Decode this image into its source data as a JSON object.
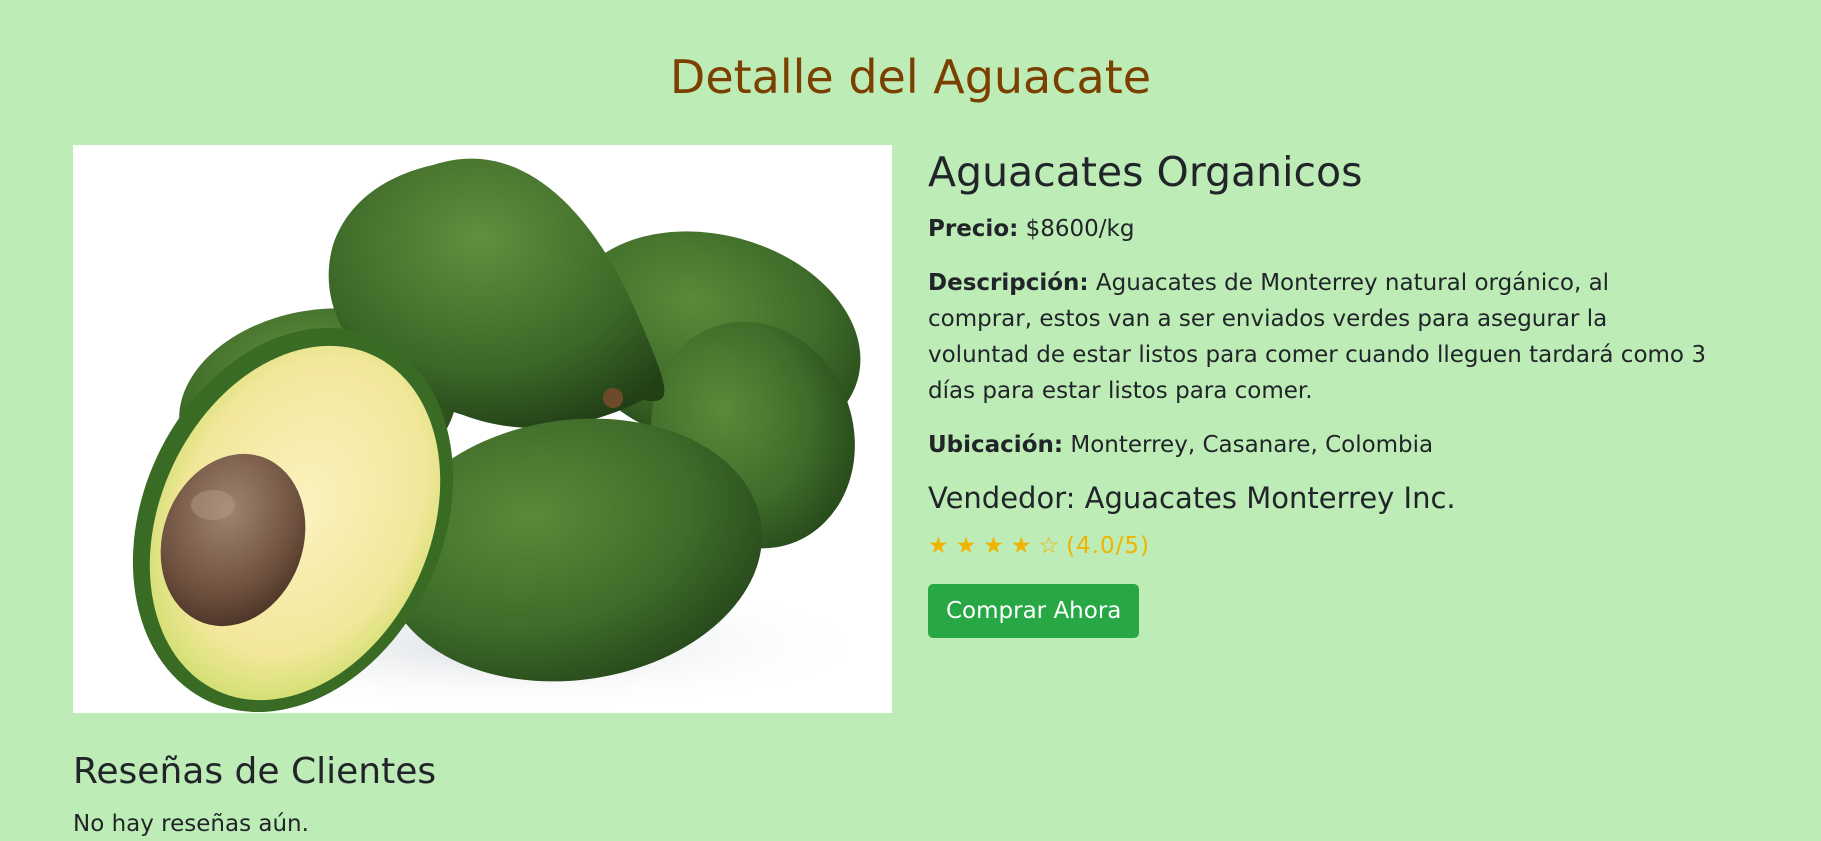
{
  "page": {
    "title": "Detalle del Aguacate"
  },
  "product": {
    "image_alt": "avocados",
    "name": "Aguacates Organicos",
    "price_label": "Precio:",
    "price_value": "$8600/kg",
    "description_label": "Descripción:",
    "description_value": "Aguacates de Monterrey natural orgánico, al comprar, estos van a ser enviados verdes para asegurar la voluntad de estar listos para comer cuando lleguen tardará como 3 días para estar listos para comer.",
    "location_label": "Ubicación:",
    "location_value": "Monterrey, Casanare, Colombia",
    "seller": "Vendedor: Aguacates Monterrey Inc.",
    "rating": {
      "stars": [
        "★",
        "★",
        "★",
        "★",
        "☆"
      ],
      "text": "(4.0/5)",
      "value": 4.0,
      "max": 5,
      "color": "#f0b400"
    },
    "buy_button_label": "Comprar Ahora"
  },
  "reviews": {
    "title": "Reseñas de Clientes",
    "empty_text": "No hay reseñas aún."
  },
  "colors": {
    "background": "#bdecb6",
    "title": "#7b3f00",
    "button": "#28a745"
  }
}
